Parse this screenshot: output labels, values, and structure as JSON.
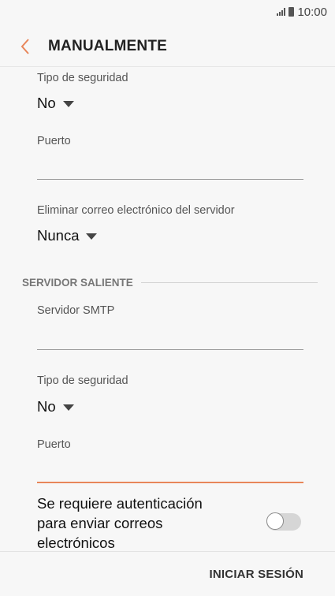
{
  "status_bar": {
    "time": "10:00",
    "icons": [
      "signal-icon",
      "battery-icon"
    ]
  },
  "header": {
    "back_icon": "chevron-left-icon",
    "title": "MANUALMENTE",
    "accent_color": "#e8865a"
  },
  "incoming": {
    "security_label": "Tipo de seguridad",
    "security_value": "No",
    "port_label": "Puerto",
    "port_value": "",
    "delete_label": "Eliminar correo electrónico del servidor",
    "delete_value": "Nunca"
  },
  "outgoing": {
    "section_title": "SERVIDOR SALIENTE",
    "smtp_label": "Servidor SMTP",
    "smtp_value": "",
    "security_label": "Tipo de seguridad",
    "security_value": "No",
    "port_label": "Puerto",
    "port_value": "",
    "auth_label": "Se requiere autenticación para enviar correos electrónicos",
    "auth_enabled": false
  },
  "footer": {
    "signin_label": "INICIAR SESIÓN"
  }
}
